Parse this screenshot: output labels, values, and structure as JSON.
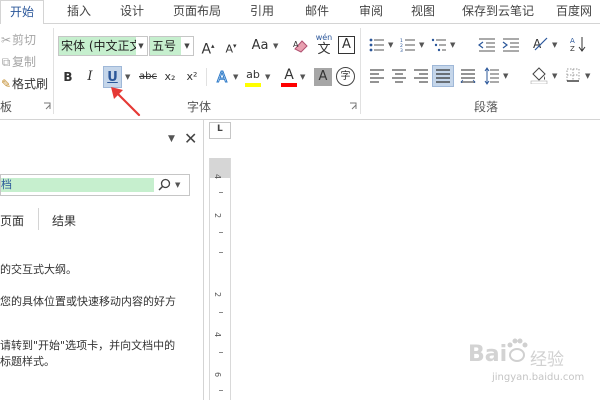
{
  "tabs": [
    "开始",
    "插入",
    "设计",
    "页面布局",
    "引用",
    "邮件",
    "审阅",
    "视图",
    "保存到云笔记",
    "百度网"
  ],
  "clipboard": {
    "cut": "剪切",
    "copy": "复制",
    "format_painter": "格式刷",
    "group_label": "板"
  },
  "font": {
    "family": "宋体 (中文正文",
    "size": "五号",
    "grow": "A",
    "shrink": "A",
    "case": "Aa",
    "pinyin_top": "wén",
    "pinyin_char": "文",
    "border_char": "A",
    "bold": "B",
    "italic": "I",
    "underline": "U",
    "strike": "abc",
    "subscript": "x₂",
    "superscript": "x²",
    "effects": "A",
    "highlight": "ab",
    "font_color": "A",
    "shade": "A",
    "enclose": "字",
    "group_label": "字体"
  },
  "paragraph": {
    "group_label": "段落"
  },
  "colors": {
    "accent": "#2b579a",
    "highlight_yellow": "#ffff00",
    "font_red": "#ff0000",
    "search_fill": "#c6efce",
    "arrow_red": "#e53935"
  },
  "navpane": {
    "search_text": "档",
    "tabs": [
      "页面",
      "结果"
    ],
    "lines": [
      "的交互式大纲。",
      "您的具体位置或快速移动内容的好方",
      "请转到\"开始\"选项卡，并向文档中的",
      "标题样式。"
    ]
  },
  "ruler": {
    "corner": "L",
    "numbers": [
      "4",
      "2",
      "2",
      "4",
      "6"
    ]
  },
  "watermark": {
    "brand": "Bai",
    "brand2": "经验",
    "url": "jingyan.baidu.com"
  }
}
